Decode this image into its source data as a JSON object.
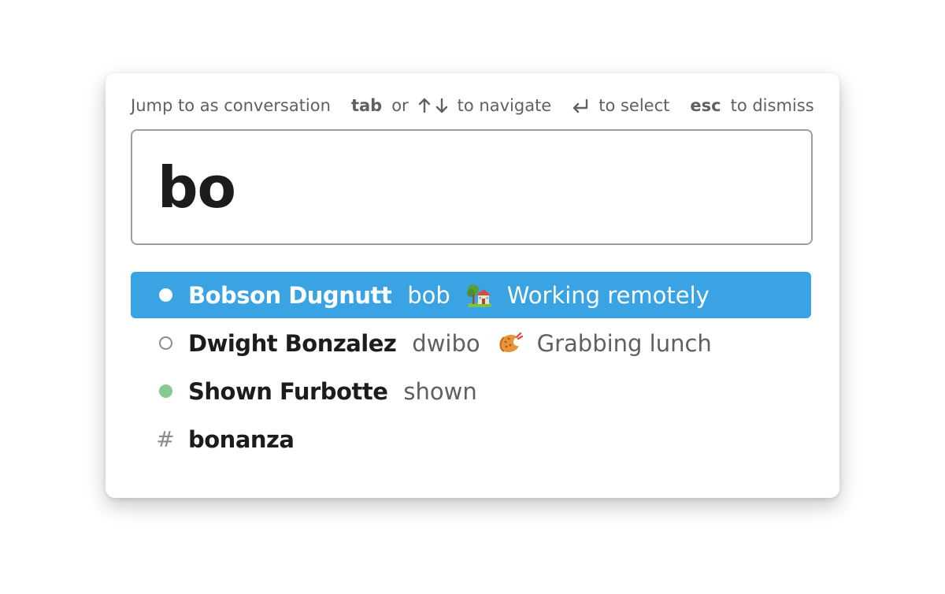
{
  "hints": {
    "intro": "Jump to as conversation",
    "tab_key": "tab",
    "or": "or",
    "nav_label": "to navigate",
    "select_label": "to select",
    "esc_key": "esc",
    "dismiss_label": "to dismiss"
  },
  "search": {
    "value": "bo"
  },
  "results": [
    {
      "type": "user",
      "presence": "active-selected",
      "name": "Bobson Dugnutt",
      "handle": "bob",
      "status_icon": "house-with-garden-icon",
      "status": "Working remotely",
      "selected": true
    },
    {
      "type": "user",
      "presence": "away",
      "name": "Dwight Bonzalez",
      "handle": "dwibo",
      "status_icon": "fried-shrimp-icon",
      "status": "Grabbing lunch",
      "selected": false
    },
    {
      "type": "user",
      "presence": "active",
      "name": "Shown Furbotte",
      "handle": "shown",
      "selected": false
    },
    {
      "type": "channel",
      "hash": "#",
      "name": "bonanza",
      "selected": false
    }
  ],
  "colors": {
    "selected_row": "#3aa3e3",
    "active_presence": "#88c98f",
    "away_presence": "#8c8c8c",
    "text_primary": "#1d1c1d",
    "text_secondary": "#616061"
  }
}
